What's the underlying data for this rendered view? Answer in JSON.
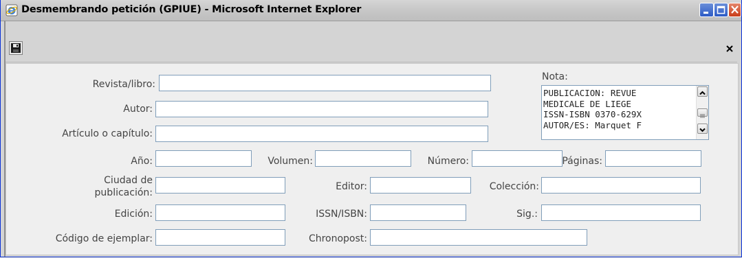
{
  "window": {
    "title": "Desmembrando petición (GPIUE) - Microsoft Internet Explorer"
  },
  "toolbar": {
    "save_icon": "floppy-disk-icon",
    "close_icon": "close-x-icon"
  },
  "form": {
    "revista_label": "Revista/libro:",
    "autor_label": "Autor:",
    "articulo_label": "Artículo o capítulo:",
    "anio_label": "Año:",
    "volumen_label": "Volumen:",
    "numero_label": "Número:",
    "paginas_label": "Páginas:",
    "ciudad_label_1": "Ciudad de",
    "ciudad_label_2": "publicación:",
    "editor_label": "Editor:",
    "coleccion_label": "Colección:",
    "edicion_label": "Edición:",
    "issn_label": "ISSN/ISBN:",
    "sig_label": "Sig.:",
    "codigo_label": "Código de ejemplar:",
    "chronopost_label": "Chronopost:",
    "nota_label": "Nota:",
    "nota_value": "PUBLICACION: REVUE\nMEDICALE DE LIEGE\nISSN-ISBN 0370-629X\nAUTOR/ES: Marquet F",
    "values": {
      "revista": "",
      "autor": "",
      "articulo": "",
      "anio": "",
      "volumen": "",
      "numero": "",
      "paginas": "",
      "ciudad": "",
      "editor": "",
      "coleccion": "",
      "edicion": "",
      "issn": "",
      "sig": "",
      "codigo": "",
      "chronopost": ""
    }
  },
  "colors": {
    "input_border": "#7f9db9",
    "form_background": "#efefef",
    "label_text": "#444444"
  }
}
